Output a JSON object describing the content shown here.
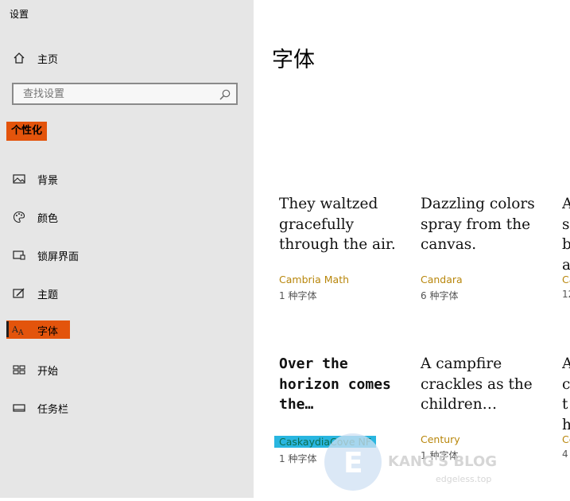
{
  "window": {
    "title": "设置"
  },
  "sidebar": {
    "home": "主页",
    "search": {
      "placeholder": "查找设置"
    },
    "section_title": "个性化",
    "items": [
      {
        "label": "背景",
        "icon": "image-icon"
      },
      {
        "label": "颜色",
        "icon": "palette-icon"
      },
      {
        "label": "锁屏界面",
        "icon": "lockscreen-icon"
      },
      {
        "label": "主题",
        "icon": "theme-icon"
      },
      {
        "label": "字体",
        "icon": "font-icon",
        "active": true
      },
      {
        "label": "开始",
        "icon": "start-icon"
      },
      {
        "label": "任务栏",
        "icon": "taskbar-icon"
      }
    ]
  },
  "main": {
    "title": "字体",
    "fonts": [
      {
        "sample": "They waltzed gracefully through the air.",
        "name": "Cambria Math",
        "count": "1 种字体"
      },
      {
        "sample": "Dazzling colors spray from the canvas.",
        "name": "Candara",
        "count": "6 种字体"
      },
      {
        "sample": "A s b a",
        "name": "Ca",
        "count": "12"
      },
      {
        "sample": "Over the horizon comes the…",
        "name": "CaskaydiaCove NF",
        "count": "1 种字体"
      },
      {
        "sample": "A campfire crackles as the children…",
        "name": "Century",
        "count": "1 种字体"
      },
      {
        "sample": "A c th",
        "name": "Ce",
        "count": "4"
      }
    ]
  },
  "watermark": {
    "text": "KANG'S BLOG",
    "url": "edgeless.top"
  },
  "colors": {
    "accent": "#e3540c",
    "highlight": "#29b6e0",
    "font_name": "#b8860b"
  }
}
